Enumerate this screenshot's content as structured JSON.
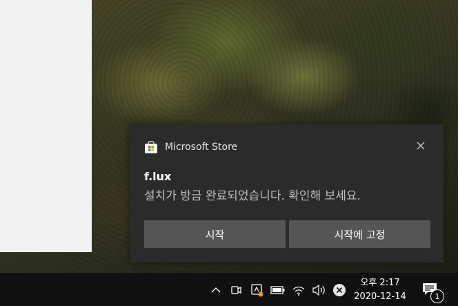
{
  "notification": {
    "app_name": "Microsoft Store",
    "title": "f.lux",
    "message": "설치가 방금 완료되었습니다. 확인해 보세요.",
    "buttons": [
      "시작",
      "시작에 고정"
    ]
  },
  "taskbar": {
    "clock_time": "오후 2:17",
    "clock_date": "2020-12-14",
    "notification_count": "1",
    "tray_icons": [
      "chevron-up-icon",
      "meet-now-icon",
      "flux-tray-icon",
      "battery-icon",
      "wifi-icon",
      "volume-icon",
      "network-disconnected-icon"
    ]
  },
  "colors": {
    "toast_background": "#2b2b2b",
    "button_background": "#555555",
    "taskbar_background": "#101010",
    "accent_orange": "#f7941d"
  }
}
